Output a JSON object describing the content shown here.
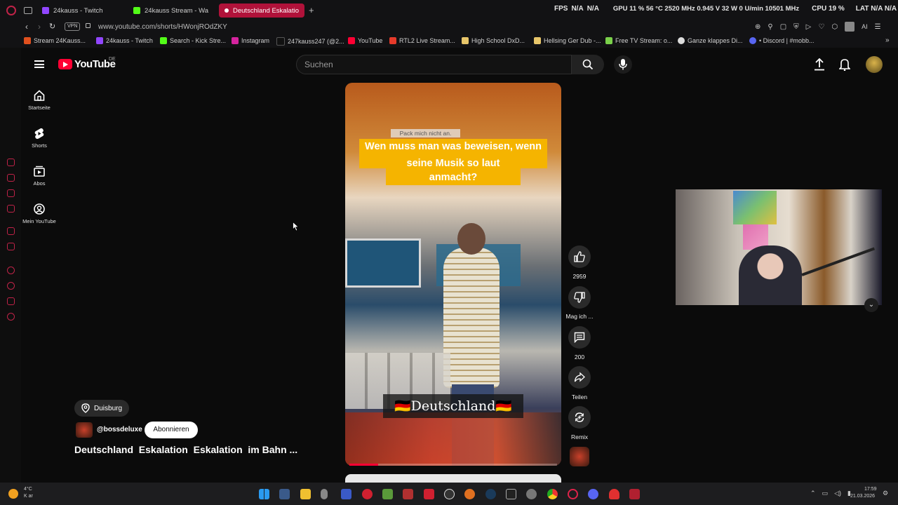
{
  "browser": {
    "tabs": [
      {
        "label": "24kauss - Twitch",
        "color": "#9146ff"
      },
      {
        "label": "24kauss Stream - Wa",
        "color": "#53fc18"
      },
      {
        "label": "Deutschland Eskalatio",
        "color": "#ff0033"
      }
    ],
    "hud": {
      "fps": "FPS",
      "fps_v1": "N/A",
      "fps_v2": "N/A",
      "gpu": "GPU 11 % 56 °C 2520 MHz 0.945 V 32 W 0 U/min 10501 MHz",
      "cpu": "CPU 19 %",
      "lat": "LAT N/A N/A"
    },
    "url": "www.youtube.com/shorts/HWonjROdZKY",
    "vpn": "VPN",
    "ai": "AI",
    "bookmarks": [
      "Stream 24Kauss...",
      "24kauss - Twitch",
      "Search - Kick Stre...",
      "Instagram",
      "247kauss247 (@2...",
      "YouTube",
      "RTL2 Live Stream...",
      "High School DxD...",
      "Hellsing Ger Dub -...",
      "Free TV Stream: o...",
      "Ganze klappes Di...",
      "• Discord | #mobb..."
    ]
  },
  "youtube": {
    "logo": "YouTube",
    "region": "DE",
    "search_placeholder": "Suchen",
    "nav": [
      {
        "label": "Startseite",
        "icon": "home-icon"
      },
      {
        "label": "Shorts",
        "icon": "shorts-icon"
      },
      {
        "label": "Abos",
        "icon": "subscriptions-icon"
      },
      {
        "label": "Mein YouTube",
        "icon": "account-icon"
      }
    ],
    "video": {
      "overlay_small": "Pack mich nicht an.",
      "caption_line1": "Wen muss man was beweisen, wenn man",
      "caption_line2": "seine Musik so laut anmacht?",
      "flag_text": "🇩🇪Deutschland🇩🇪",
      "progress": 0.14
    },
    "actions": {
      "like_count": "2959",
      "dislike_label": "Mag ich ...",
      "comment_count": "200",
      "share_label": "Teilen",
      "remix_label": "Remix"
    },
    "location": "Duisburg",
    "channel": "@bossdeluxe",
    "subscribe": "Abonnieren",
    "title": "Deutschland  Eskalation  Eskalation  im Bahn ..."
  },
  "taskbar": {
    "weather_temp": "4°C",
    "weather_desc": "K ar",
    "time": "17:59",
    "date": "21.03.2026"
  },
  "colors": {
    "accent": "#ff0033",
    "opera": "#c02348",
    "caption_bg": "#f5b400"
  }
}
